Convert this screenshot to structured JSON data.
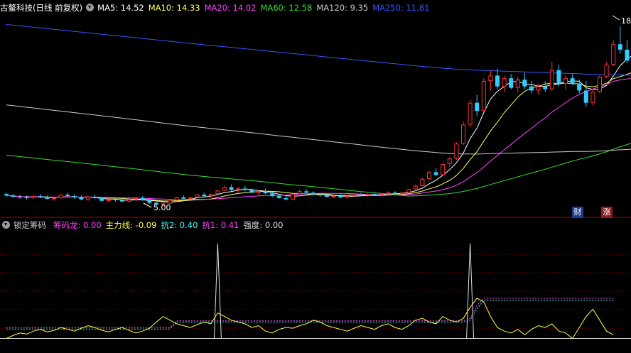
{
  "header": {
    "stock": "古鳌科技(日线 前复权)",
    "ma": [
      {
        "label": "MA5: 14.52",
        "color": "#ffffff"
      },
      {
        "label": "MA10: 14.33",
        "color": "#ffff66"
      },
      {
        "label": "MA20: 14.02",
        "color": "#ff44ff"
      },
      {
        "label": "MA60: 12.58",
        "color": "#33dd33"
      },
      {
        "label": "MA120: 9.35",
        "color": "#cccccc"
      },
      {
        "label": "MA250: 11.81",
        "color": "#3355ff"
      }
    ]
  },
  "price_annotations": {
    "low": "5.00",
    "high": "18"
  },
  "badges": {
    "finance": "财",
    "rise": "涨"
  },
  "indicator": {
    "name": "锁定筹码",
    "values": [
      {
        "label": "筹码龙: 0.00",
        "color": "#ff44ff"
      },
      {
        "label": "主力线: -0.09",
        "color": "#ffff44"
      },
      {
        "label": "抗2: 0.40",
        "color": "#44ffff"
      },
      {
        "label": "抗1: 0.41",
        "color": "#ff44ff"
      },
      {
        "label": "强度: 0.00",
        "color": "#dddddd"
      }
    ]
  },
  "colors": {
    "up": "#ff3333",
    "down": "#33ccff",
    "background": "#000000",
    "grid": "#7a0000"
  },
  "chart_data": [
    {
      "type": "candlestick",
      "title": "古鳌科技(日线 前复权)",
      "ylim": [
        4.5,
        19
      ],
      "candles": [
        [
          5.9,
          6.0,
          5.7,
          5.8
        ],
        [
          5.8,
          5.9,
          5.6,
          5.7
        ],
        [
          5.7,
          5.85,
          5.55,
          5.65
        ],
        [
          5.65,
          5.8,
          5.5,
          5.6
        ],
        [
          5.6,
          5.85,
          5.5,
          5.75
        ],
        [
          5.75,
          5.9,
          5.6,
          5.7
        ],
        [
          5.7,
          5.8,
          5.5,
          5.55
        ],
        [
          5.55,
          5.7,
          5.4,
          5.6
        ],
        [
          5.6,
          5.9,
          5.55,
          5.85
        ],
        [
          5.85,
          6.0,
          5.7,
          5.75
        ],
        [
          5.75,
          5.9,
          5.55,
          5.65
        ],
        [
          5.65,
          5.8,
          5.45,
          5.5
        ],
        [
          5.5,
          5.75,
          5.4,
          5.7
        ],
        [
          5.7,
          5.85,
          5.55,
          5.6
        ],
        [
          5.6,
          5.7,
          5.35,
          5.4
        ],
        [
          5.4,
          5.6,
          5.3,
          5.5
        ],
        [
          5.5,
          5.65,
          5.35,
          5.45
        ],
        [
          5.45,
          5.6,
          5.3,
          5.35
        ],
        [
          5.35,
          5.55,
          5.25,
          5.5
        ],
        [
          5.5,
          5.7,
          5.4,
          5.6
        ],
        [
          5.6,
          5.75,
          5.4,
          5.45
        ],
        [
          5.45,
          5.55,
          5.2,
          5.25
        ],
        [
          5.25,
          5.4,
          5.05,
          5.15
        ],
        [
          5.15,
          5.3,
          5.0,
          5.2
        ],
        [
          5.2,
          5.5,
          5.15,
          5.45
        ],
        [
          5.45,
          5.7,
          5.4,
          5.65
        ],
        [
          5.65,
          5.8,
          5.5,
          5.55
        ],
        [
          5.55,
          5.7,
          5.45,
          5.65
        ],
        [
          5.65,
          5.9,
          5.6,
          5.85
        ],
        [
          5.85,
          6.0,
          5.7,
          5.75
        ],
        [
          5.75,
          5.95,
          5.65,
          5.9
        ],
        [
          5.9,
          6.2,
          5.85,
          6.15
        ],
        [
          6.15,
          6.5,
          6.1,
          6.4
        ],
        [
          6.4,
          6.6,
          6.1,
          6.2
        ],
        [
          6.2,
          6.4,
          6.0,
          6.3
        ],
        [
          6.3,
          6.5,
          6.1,
          6.2
        ],
        [
          6.2,
          6.3,
          5.95,
          6.0
        ],
        [
          6.0,
          6.2,
          5.85,
          6.1
        ],
        [
          6.1,
          6.3,
          5.9,
          5.95
        ],
        [
          5.95,
          6.05,
          5.7,
          5.75
        ],
        [
          5.75,
          5.9,
          5.55,
          5.6
        ],
        [
          5.6,
          5.75,
          5.45,
          5.5
        ],
        [
          5.5,
          5.95,
          5.45,
          5.9
        ],
        [
          5.9,
          6.2,
          5.85,
          6.1
        ],
        [
          6.1,
          6.25,
          5.95,
          6.0
        ],
        [
          6.0,
          6.1,
          5.8,
          5.85
        ],
        [
          5.85,
          5.95,
          5.7,
          5.8
        ],
        [
          5.8,
          5.9,
          5.65,
          5.7
        ],
        [
          5.7,
          5.85,
          5.6,
          5.75
        ],
        [
          5.75,
          5.9,
          5.6,
          5.65
        ],
        [
          5.65,
          5.8,
          5.55,
          5.75
        ],
        [
          5.75,
          5.9,
          5.7,
          5.85
        ],
        [
          5.85,
          6.0,
          5.75,
          5.8
        ],
        [
          5.8,
          5.95,
          5.7,
          5.9
        ],
        [
          5.9,
          6.0,
          5.75,
          5.85
        ],
        [
          5.85,
          6.0,
          5.75,
          5.95
        ],
        [
          5.95,
          6.1,
          5.85,
          6.0
        ],
        [
          6.0,
          6.1,
          5.85,
          5.9
        ],
        [
          5.9,
          6.05,
          5.8,
          6.0
        ],
        [
          6.0,
          6.3,
          5.95,
          6.25
        ],
        [
          6.25,
          6.6,
          6.2,
          6.5
        ],
        [
          6.5,
          7.1,
          6.45,
          7.0
        ],
        [
          7.0,
          7.6,
          6.9,
          7.5
        ],
        [
          7.5,
          7.8,
          7.2,
          7.3
        ],
        [
          7.3,
          8.2,
          7.25,
          8.1
        ],
        [
          8.1,
          8.6,
          7.9,
          8.5
        ],
        [
          8.5,
          9.7,
          8.4,
          9.6
        ],
        [
          9.6,
          11.2,
          9.5,
          11.0
        ],
        [
          11.0,
          12.8,
          10.8,
          12.6
        ],
        [
          12.6,
          13.2,
          11.6,
          12.0
        ],
        [
          12.0,
          14.4,
          11.9,
          14.2
        ],
        [
          14.2,
          15.0,
          13.5,
          14.6
        ],
        [
          14.6,
          15.1,
          13.6,
          13.8
        ],
        [
          13.8,
          14.6,
          13.4,
          14.4
        ],
        [
          14.4,
          14.7,
          13.6,
          13.7
        ],
        [
          13.7,
          14.5,
          13.4,
          14.3
        ],
        [
          14.3,
          14.8,
          13.6,
          13.8
        ],
        [
          13.8,
          14.2,
          13.3,
          13.5
        ],
        [
          13.5,
          14.0,
          13.2,
          13.8
        ],
        [
          13.8,
          14.2,
          13.4,
          13.6
        ],
        [
          13.6,
          15.6,
          13.5,
          15.0
        ],
        [
          15.0,
          15.4,
          13.8,
          14.0
        ],
        [
          14.0,
          14.6,
          13.6,
          14.4
        ],
        [
          14.4,
          14.7,
          13.9,
          14.0
        ],
        [
          14.0,
          14.3,
          13.3,
          13.5
        ],
        [
          13.5,
          14.2,
          12.3,
          12.6
        ],
        [
          12.6,
          13.6,
          12.4,
          13.4
        ],
        [
          13.4,
          14.6,
          13.3,
          14.5
        ],
        [
          14.5,
          15.6,
          14.4,
          15.4
        ],
        [
          15.4,
          17.2,
          15.3,
          16.9
        ],
        [
          16.9,
          18.2,
          16.2,
          16.5
        ],
        [
          16.5,
          17.2,
          15.5,
          15.7
        ],
        [
          15.7,
          16.6,
          15.2,
          16.3
        ],
        [
          16.3,
          16.8,
          15.6,
          16.0
        ]
      ],
      "ma_lines": [
        "MA5",
        "MA10",
        "MA20",
        "MA60",
        "MA120",
        "MA250"
      ]
    },
    {
      "type": "line",
      "title": "锁定筹码",
      "series": [
        {
          "name": "主力线",
          "values": [
            0.0,
            0.08,
            0.15,
            0.12,
            0.2,
            0.25,
            0.18,
            0.22,
            0.3,
            0.25,
            0.2,
            0.28,
            0.35,
            0.3,
            0.22,
            0.18,
            0.25,
            0.3,
            0.22,
            0.15,
            0.2,
            0.28,
            0.45,
            0.6,
            0.5,
            0.4,
            0.35,
            0.3,
            0.38,
            0.45,
            0.4,
            0.7,
            0.6,
            0.5,
            0.45,
            0.4,
            0.3,
            0.35,
            0.2,
            0.15,
            0.25,
            0.3,
            0.28,
            0.35,
            0.4,
            0.5,
            0.45,
            0.35,
            0.3,
            0.25,
            0.2,
            0.28,
            0.35,
            0.3,
            0.25,
            0.35,
            0.4,
            0.3,
            0.25,
            0.35,
            0.5,
            0.55,
            0.45,
            0.4,
            0.6,
            0.5,
            0.45,
            0.55,
            0.85,
            1.1,
            1.0,
            0.6,
            0.3,
            0.2,
            0.15,
            0.25,
            0.1,
            0.25,
            0.35,
            0.3,
            0.4,
            0.2,
            0.15,
            0.0,
            0.3,
            0.6,
            0.8,
            0.5,
            0.2,
            0.1
          ]
        },
        {
          "name": "抗2",
          "values": [
            0.26,
            0.26,
            0.26,
            0.26,
            0.26,
            0.26,
            0.26,
            0.26,
            0.26,
            0.26,
            0.26,
            0.26,
            0.26,
            0.26,
            0.26,
            0.26,
            0.26,
            0.26,
            0.26,
            0.26,
            0.26,
            0.26,
            0.26,
            0.26,
            0.26,
            0.45,
            0.45,
            0.45,
            0.45,
            0.45,
            0.45,
            0.45,
            0.45,
            0.45,
            0.45,
            0.45,
            0.45,
            0.45,
            0.45,
            0.45,
            0.45,
            0.45,
            0.45,
            0.45,
            0.45,
            0.45,
            0.45,
            0.45,
            0.45,
            0.45,
            0.45,
            0.45,
            0.45,
            0.45,
            0.45,
            0.45,
            0.45,
            0.45,
            0.45,
            0.45,
            0.45,
            0.45,
            0.45,
            0.45,
            0.45,
            0.45,
            0.45,
            0.45,
            0.5,
            0.8,
            1.05,
            1.05,
            1.05,
            1.05,
            1.05,
            1.05,
            1.05,
            1.05,
            1.05,
            1.05,
            1.05,
            1.05,
            1.05,
            1.05,
            1.05,
            1.05,
            1.05,
            1.05,
            1.05,
            1.05
          ]
        },
        {
          "name": "抗1",
          "values": [
            0.3,
            0.3,
            0.3,
            0.3,
            0.3,
            0.3,
            0.3,
            0.3,
            0.3,
            0.3,
            0.3,
            0.3,
            0.3,
            0.3,
            0.3,
            0.3,
            0.3,
            0.3,
            0.3,
            0.3,
            0.3,
            0.3,
            0.3,
            0.3,
            0.3,
            0.48,
            0.48,
            0.48,
            0.48,
            0.48,
            0.48,
            0.48,
            0.48,
            0.48,
            0.48,
            0.48,
            0.48,
            0.48,
            0.48,
            0.48,
            0.48,
            0.48,
            0.48,
            0.48,
            0.48,
            0.48,
            0.48,
            0.48,
            0.48,
            0.48,
            0.48,
            0.48,
            0.48,
            0.48,
            0.48,
            0.48,
            0.48,
            0.48,
            0.48,
            0.48,
            0.48,
            0.48,
            0.48,
            0.48,
            0.48,
            0.48,
            0.48,
            0.48,
            0.55,
            0.9,
            1.1,
            1.1,
            1.1,
            1.1,
            1.1,
            1.1,
            1.1,
            1.1,
            1.1,
            1.1,
            1.1,
            1.1,
            1.1,
            1.1,
            1.1,
            1.1,
            1.1,
            1.1,
            1.1,
            1.1
          ]
        },
        {
          "name": "强度",
          "spikes": [
            {
              "index": 31,
              "value": 2.6
            },
            {
              "index": 68,
              "value": 2.6
            }
          ]
        }
      ],
      "ylim": [
        -0.3,
        3.0
      ],
      "baseline": 0.0
    }
  ]
}
